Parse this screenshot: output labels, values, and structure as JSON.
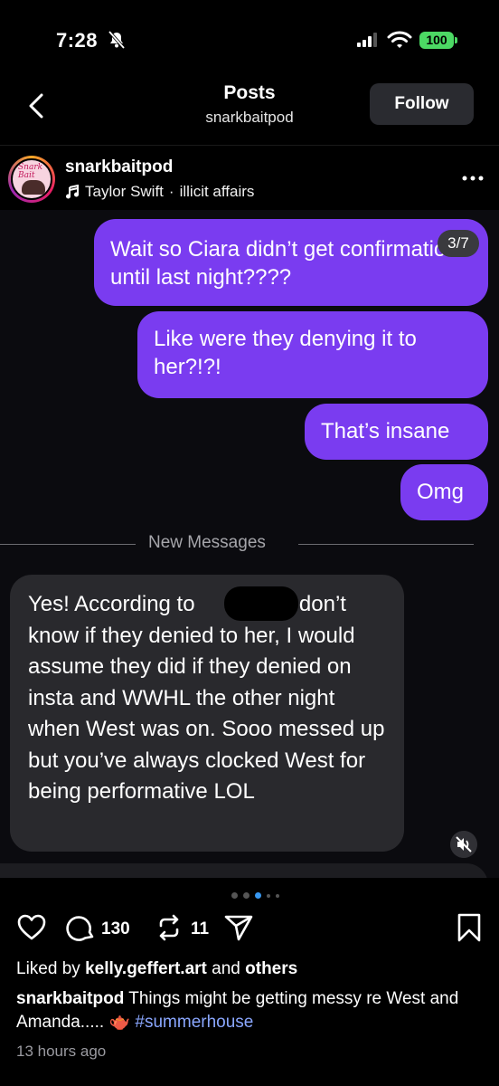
{
  "status_bar": {
    "time": "7:28",
    "battery": "100",
    "icons": [
      "bell-slash-icon",
      "signal-icon",
      "wifi-icon",
      "battery-icon"
    ],
    "battery_color": "#4cd964"
  },
  "nav": {
    "title": "Posts",
    "subtitle": "snarkbaitpod",
    "follow_label": "Follow"
  },
  "post": {
    "username": "snarkbaitpod",
    "music_artist": "Taylor Swift",
    "music_separator": "·",
    "music_track": "illicit affairs",
    "avatar_text": "Snark Bait",
    "carousel_position": "3/7"
  },
  "messages": {
    "outgoing": [
      "Wait so Ciara didn’t get confirmation until last night????",
      "Like were they denying it to her?!?!",
      "That’s insane",
      "Omg"
    ],
    "divider_label": "New Messages",
    "incoming": "Yes! According to ████ I don’t know if they denied to her, I would assume they did if they denied on insta and WWHL the other night when West was on. Sooo messed up but you’ve always clocked West for being performative LOL",
    "incoming_before_redaction": "Yes! According to",
    "incoming_after_redaction": "I don’t know if they denied to her, I would assume they did if they denied on insta and WWHL the other night when West was on. Sooo messed up but you’ve always clocked West for being performative LOL",
    "outgoing_color": "#7a3cf0",
    "incoming_color": "#29292d"
  },
  "carousel": {
    "total_dots": 5,
    "active_dot": 2
  },
  "actions": {
    "comments_count": "130",
    "reposts_count": "11"
  },
  "likes": {
    "prefix": "Liked by",
    "user": "kelly.geffert.art",
    "connector": "and",
    "suffix": "others"
  },
  "caption": {
    "username": "snarkbaitpod",
    "text": "Things might be getting messy re West and Amanda.....",
    "emoji": "🫖",
    "hashtag": "#summerhouse"
  },
  "timestamp": "13 hours ago",
  "accent_color": "#3797f0"
}
